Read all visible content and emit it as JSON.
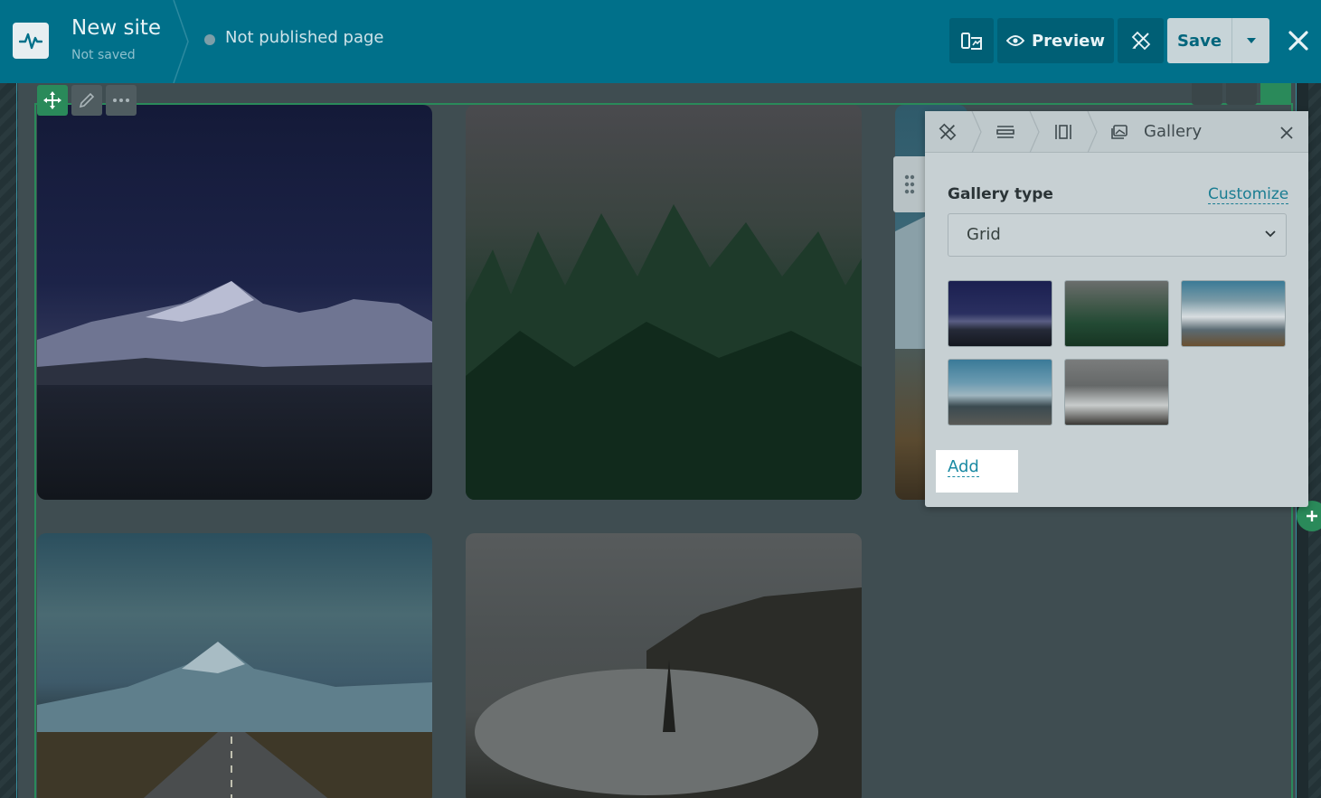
{
  "header": {
    "site_title": "New site",
    "save_status": "Not saved",
    "page_status": "Not published page",
    "preview_label": "Preview",
    "save_label": "Save"
  },
  "icons": {
    "logo": "pulse-logo-icon",
    "layers": "pages-icon",
    "preview": "eye-icon",
    "design": "design-tools-icon",
    "save_dropdown": "caret-down-icon",
    "close": "close-icon"
  },
  "gallery_panel": {
    "title": "Gallery",
    "gallery_type_label": "Gallery type",
    "customize_label": "Customize",
    "selected_type": "Grid",
    "add_label": "Add",
    "thumbnails": [
      "mountain-night",
      "foggy-forest",
      "snowy-peaks",
      "mountain-road",
      "misty-trees"
    ]
  },
  "colors": {
    "header_bg": "#00708a",
    "accent": "#1a8aa3",
    "selection_green": "#2a8a5a"
  }
}
